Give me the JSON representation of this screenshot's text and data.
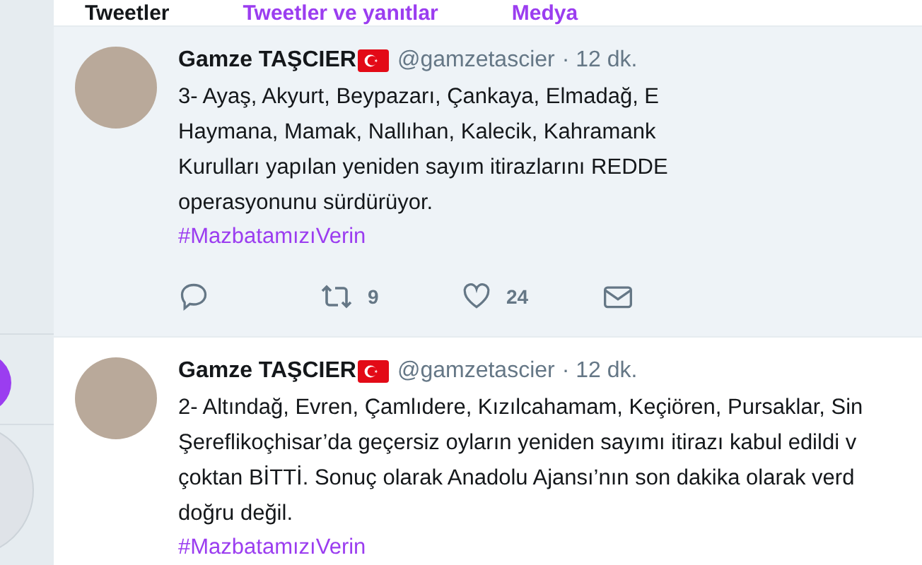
{
  "tabs": [
    {
      "label": "Tweetler",
      "selected": true
    },
    {
      "label": "Tweetler ve yanıtlar",
      "selected": false
    },
    {
      "label": "Medya",
      "selected": false
    }
  ],
  "tweets": [
    {
      "name": "Gamze TAŞCIER",
      "handle": "@gamzetascier",
      "time": "· 12 dk.",
      "highlighted": true,
      "lines": [
        "3- Ayaş, Akyurt, Beypazarı, Çankaya, Elmadağ, E",
        "Haymana, Mamak, Nallıhan, Kalecik, Kahramank",
        "Kurulları yapılan yeniden sayım itirazlarını REDDE",
        "operasyonunu sürdürüyor."
      ],
      "hashtag": "#MazbatamızıVerin",
      "retweets": "9",
      "likes": "24"
    },
    {
      "name": "Gamze TAŞCIER",
      "handle": "@gamzetascier",
      "time": "· 12 dk.",
      "highlighted": false,
      "lines": [
        "2- Altındağ, Evren, Çamlıdere, Kızılcahamam, Keçiören, Pursaklar, Sin",
        "Şereflikoçhisar’da geçersiz oyların yeniden sayımı itirazı kabul edildi v",
        "çoktan BİTTİ. Sonuç olarak Anadolu Ajansı’nın son dakika olarak verd",
        "doğru değil."
      ],
      "hashtag": "#MazbatamızıVerin"
    }
  ]
}
